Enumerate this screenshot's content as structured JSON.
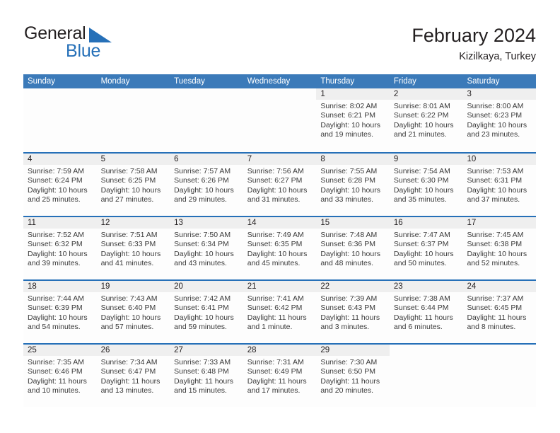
{
  "brand": {
    "name_dark": "General",
    "name_blue": "Blue",
    "mark": "triangle-logo"
  },
  "header": {
    "title": "February 2024",
    "subtitle": "Kizilkaya, Turkey"
  },
  "colors": {
    "header_blue": "#3b7ab9",
    "divider_blue": "#2670b8",
    "daynum_gray": "#efefef",
    "brand_blue": "#2670b8",
    "text": "#231f20"
  },
  "weekdays": [
    "Sunday",
    "Monday",
    "Tuesday",
    "Wednesday",
    "Thursday",
    "Friday",
    "Saturday"
  ],
  "weeks": [
    [
      {
        "day": "",
        "sunrise": "",
        "sunset": "",
        "daylight_line1": "",
        "daylight_line2": "",
        "blank": true
      },
      {
        "day": "",
        "sunrise": "",
        "sunset": "",
        "daylight_line1": "",
        "daylight_line2": "",
        "blank": true
      },
      {
        "day": "",
        "sunrise": "",
        "sunset": "",
        "daylight_line1": "",
        "daylight_line2": "",
        "blank": true
      },
      {
        "day": "",
        "sunrise": "",
        "sunset": "",
        "daylight_line1": "",
        "daylight_line2": "",
        "blank": true
      },
      {
        "day": "1",
        "sunrise": "Sunrise: 8:02 AM",
        "sunset": "Sunset: 6:21 PM",
        "daylight_line1": "Daylight: 10 hours",
        "daylight_line2": "and 19 minutes."
      },
      {
        "day": "2",
        "sunrise": "Sunrise: 8:01 AM",
        "sunset": "Sunset: 6:22 PM",
        "daylight_line1": "Daylight: 10 hours",
        "daylight_line2": "and 21 minutes."
      },
      {
        "day": "3",
        "sunrise": "Sunrise: 8:00 AM",
        "sunset": "Sunset: 6:23 PM",
        "daylight_line1": "Daylight: 10 hours",
        "daylight_line2": "and 23 minutes."
      }
    ],
    [
      {
        "day": "4",
        "sunrise": "Sunrise: 7:59 AM",
        "sunset": "Sunset: 6:24 PM",
        "daylight_line1": "Daylight: 10 hours",
        "daylight_line2": "and 25 minutes."
      },
      {
        "day": "5",
        "sunrise": "Sunrise: 7:58 AM",
        "sunset": "Sunset: 6:25 PM",
        "daylight_line1": "Daylight: 10 hours",
        "daylight_line2": "and 27 minutes."
      },
      {
        "day": "6",
        "sunrise": "Sunrise: 7:57 AM",
        "sunset": "Sunset: 6:26 PM",
        "daylight_line1": "Daylight: 10 hours",
        "daylight_line2": "and 29 minutes."
      },
      {
        "day": "7",
        "sunrise": "Sunrise: 7:56 AM",
        "sunset": "Sunset: 6:27 PM",
        "daylight_line1": "Daylight: 10 hours",
        "daylight_line2": "and 31 minutes."
      },
      {
        "day": "8",
        "sunrise": "Sunrise: 7:55 AM",
        "sunset": "Sunset: 6:28 PM",
        "daylight_line1": "Daylight: 10 hours",
        "daylight_line2": "and 33 minutes."
      },
      {
        "day": "9",
        "sunrise": "Sunrise: 7:54 AM",
        "sunset": "Sunset: 6:30 PM",
        "daylight_line1": "Daylight: 10 hours",
        "daylight_line2": "and 35 minutes."
      },
      {
        "day": "10",
        "sunrise": "Sunrise: 7:53 AM",
        "sunset": "Sunset: 6:31 PM",
        "daylight_line1": "Daylight: 10 hours",
        "daylight_line2": "and 37 minutes."
      }
    ],
    [
      {
        "day": "11",
        "sunrise": "Sunrise: 7:52 AM",
        "sunset": "Sunset: 6:32 PM",
        "daylight_line1": "Daylight: 10 hours",
        "daylight_line2": "and 39 minutes."
      },
      {
        "day": "12",
        "sunrise": "Sunrise: 7:51 AM",
        "sunset": "Sunset: 6:33 PM",
        "daylight_line1": "Daylight: 10 hours",
        "daylight_line2": "and 41 minutes."
      },
      {
        "day": "13",
        "sunrise": "Sunrise: 7:50 AM",
        "sunset": "Sunset: 6:34 PM",
        "daylight_line1": "Daylight: 10 hours",
        "daylight_line2": "and 43 minutes."
      },
      {
        "day": "14",
        "sunrise": "Sunrise: 7:49 AM",
        "sunset": "Sunset: 6:35 PM",
        "daylight_line1": "Daylight: 10 hours",
        "daylight_line2": "and 45 minutes."
      },
      {
        "day": "15",
        "sunrise": "Sunrise: 7:48 AM",
        "sunset": "Sunset: 6:36 PM",
        "daylight_line1": "Daylight: 10 hours",
        "daylight_line2": "and 48 minutes."
      },
      {
        "day": "16",
        "sunrise": "Sunrise: 7:47 AM",
        "sunset": "Sunset: 6:37 PM",
        "daylight_line1": "Daylight: 10 hours",
        "daylight_line2": "and 50 minutes."
      },
      {
        "day": "17",
        "sunrise": "Sunrise: 7:45 AM",
        "sunset": "Sunset: 6:38 PM",
        "daylight_line1": "Daylight: 10 hours",
        "daylight_line2": "and 52 minutes."
      }
    ],
    [
      {
        "day": "18",
        "sunrise": "Sunrise: 7:44 AM",
        "sunset": "Sunset: 6:39 PM",
        "daylight_line1": "Daylight: 10 hours",
        "daylight_line2": "and 54 minutes."
      },
      {
        "day": "19",
        "sunrise": "Sunrise: 7:43 AM",
        "sunset": "Sunset: 6:40 PM",
        "daylight_line1": "Daylight: 10 hours",
        "daylight_line2": "and 57 minutes."
      },
      {
        "day": "20",
        "sunrise": "Sunrise: 7:42 AM",
        "sunset": "Sunset: 6:41 PM",
        "daylight_line1": "Daylight: 10 hours",
        "daylight_line2": "and 59 minutes."
      },
      {
        "day": "21",
        "sunrise": "Sunrise: 7:41 AM",
        "sunset": "Sunset: 6:42 PM",
        "daylight_line1": "Daylight: 11 hours",
        "daylight_line2": "and 1 minute."
      },
      {
        "day": "22",
        "sunrise": "Sunrise: 7:39 AM",
        "sunset": "Sunset: 6:43 PM",
        "daylight_line1": "Daylight: 11 hours",
        "daylight_line2": "and 3 minutes."
      },
      {
        "day": "23",
        "sunrise": "Sunrise: 7:38 AM",
        "sunset": "Sunset: 6:44 PM",
        "daylight_line1": "Daylight: 11 hours",
        "daylight_line2": "and 6 minutes."
      },
      {
        "day": "24",
        "sunrise": "Sunrise: 7:37 AM",
        "sunset": "Sunset: 6:45 PM",
        "daylight_line1": "Daylight: 11 hours",
        "daylight_line2": "and 8 minutes."
      }
    ],
    [
      {
        "day": "25",
        "sunrise": "Sunrise: 7:35 AM",
        "sunset": "Sunset: 6:46 PM",
        "daylight_line1": "Daylight: 11 hours",
        "daylight_line2": "and 10 minutes."
      },
      {
        "day": "26",
        "sunrise": "Sunrise: 7:34 AM",
        "sunset": "Sunset: 6:47 PM",
        "daylight_line1": "Daylight: 11 hours",
        "daylight_line2": "and 13 minutes."
      },
      {
        "day": "27",
        "sunrise": "Sunrise: 7:33 AM",
        "sunset": "Sunset: 6:48 PM",
        "daylight_line1": "Daylight: 11 hours",
        "daylight_line2": "and 15 minutes."
      },
      {
        "day": "28",
        "sunrise": "Sunrise: 7:31 AM",
        "sunset": "Sunset: 6:49 PM",
        "daylight_line1": "Daylight: 11 hours",
        "daylight_line2": "and 17 minutes."
      },
      {
        "day": "29",
        "sunrise": "Sunrise: 7:30 AM",
        "sunset": "Sunset: 6:50 PM",
        "daylight_line1": "Daylight: 11 hours",
        "daylight_line2": "and 20 minutes."
      },
      {
        "day": "",
        "sunrise": "",
        "sunset": "",
        "daylight_line1": "",
        "daylight_line2": "",
        "blank": true
      },
      {
        "day": "",
        "sunrise": "",
        "sunset": "",
        "daylight_line1": "",
        "daylight_line2": "",
        "blank": true
      }
    ]
  ]
}
